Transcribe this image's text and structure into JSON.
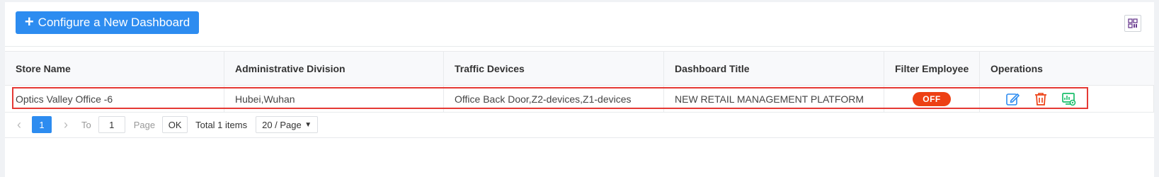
{
  "toolbar": {
    "add_button_label": "Configure a New Dashboard",
    "plus_glyph": "+",
    "layout_icon": "grid-layout-icon"
  },
  "table": {
    "columns": [
      "Store Name",
      "Administrative Division",
      "Traffic Devices",
      "Dashboard Title",
      "Filter Employee",
      "Operations"
    ],
    "rows": [
      {
        "store_name": "Optics Valley Office -6",
        "division": "Hubei,Wuhan",
        "devices": "Office Back Door,Z2-devices,Z1-devices",
        "dashboard_title": "NEW RETAIL MANAGEMENT PLATFORM",
        "filter_employee": "OFF",
        "operations": [
          "edit-icon",
          "delete-icon",
          "monitor-settings-icon"
        ]
      }
    ]
  },
  "pagination": {
    "current_page": "1",
    "to_label": "To",
    "page_input": "1",
    "page_label": "Page",
    "ok_label": "OK",
    "total_text": "Total 1 items",
    "page_size": "20 / Page"
  },
  "colors": {
    "primary": "#2d8cf0",
    "danger": "#ed4014",
    "success": "#19be6b",
    "highlight": "#e53935"
  }
}
